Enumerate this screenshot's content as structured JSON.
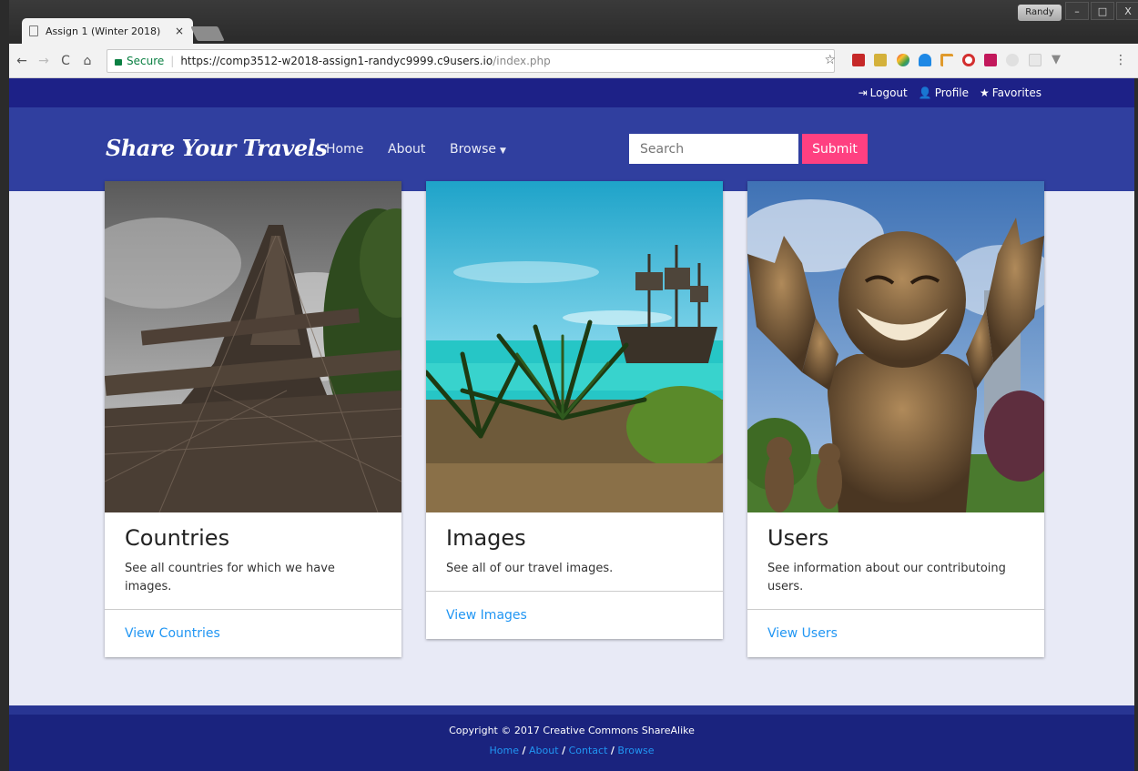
{
  "browser": {
    "tab_title": "Assign 1 (Winter 2018)",
    "tab_close": "×",
    "user_chip": "Randy",
    "window_buttons": [
      "–",
      "□",
      "X"
    ],
    "secure_label": "Secure",
    "url_main": "https://comp3512-w2018-assign1-randyc9999.c9users.io",
    "url_path": "/index.php",
    "nav_icons": [
      "back-icon",
      "forward-icon",
      "reload-icon",
      "home-icon"
    ]
  },
  "topbar": {
    "logout": "Logout",
    "profile": "Profile",
    "favorites": "Favorites"
  },
  "navbar": {
    "brand": "Share Your Travels",
    "home": "Home",
    "about": "About",
    "browse": "Browse",
    "search_placeholder": "Search",
    "submit": "Submit"
  },
  "cards": [
    {
      "title": "Countries",
      "text": "See all countries for which we have images.",
      "link": "View Countries",
      "image": "eiffel-tower-photo"
    },
    {
      "title": "Images",
      "text": "See all of our travel images.",
      "link": "View Images",
      "image": "pirate-ship-beach-photo"
    },
    {
      "title": "Users",
      "text": "See information about our contributoing users.",
      "link": "View Users",
      "image": "laughing-statue-photo"
    }
  ],
  "footer": {
    "copyright": "Copyright © 2017 Creative Commons ShareAlike",
    "links": [
      "Home",
      "About",
      "Contact",
      "Browse"
    ],
    "separator": "/"
  },
  "colors": {
    "top_strip": "#1d2187",
    "navbar": "#303f9f",
    "page_bg": "#e8eaf6",
    "accent": "#ff4081",
    "link": "#2196f3",
    "footer": "#1a237e"
  }
}
